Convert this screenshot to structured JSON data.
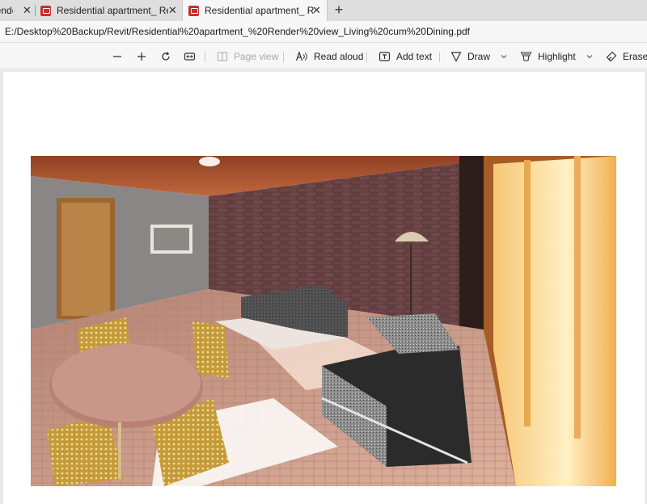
{
  "tabs": [
    {
      "label": "Render vi",
      "state": "inactive"
    },
    {
      "label": "Residential apartment_ Render vi",
      "state": "inactive"
    },
    {
      "label": "Residential apartment_ Render vi",
      "state": "active"
    }
  ],
  "address": {
    "url": "E:/Desktop%20Backup/Revit/Residential%20apartment_%20Render%20view_Living%20cum%20Dining.pdf"
  },
  "toolbar": {
    "zoom_out_icon": "minus-icon",
    "zoom_in_icon": "plus-icon",
    "rotate_icon": "rotate-icon",
    "fit_icon": "fit-to-width-icon",
    "page_view_label": "Page view",
    "read_aloud_label": "Read aloud",
    "add_text_label": "Add text",
    "draw_label": "Draw",
    "highlight_label": "Highlight",
    "erase_label": "Erase"
  },
  "document": {
    "content": "Rendered interior view of living and dining room",
    "colors": {
      "ceiling": "#a4502e",
      "brick": "#5b3a3d",
      "floor": "#c69584",
      "window_light": "#fde6a6",
      "sofa": "#2d2d2d"
    }
  }
}
